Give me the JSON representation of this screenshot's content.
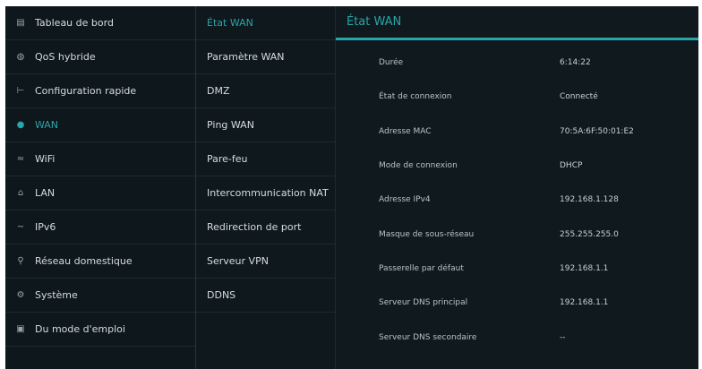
{
  "sidebar": {
    "items": [
      {
        "label": "Tableau de bord",
        "icon": "dashboard-icon",
        "glyph": "▤"
      },
      {
        "label": "QoS hybride",
        "icon": "qos-icon",
        "glyph": "◍"
      },
      {
        "label": "Configuration rapide",
        "icon": "quick-setup-icon",
        "glyph": "⊢"
      },
      {
        "label": "WAN",
        "icon": "globe-icon",
        "glyph": "●"
      },
      {
        "label": "WiFi",
        "icon": "wifi-icon",
        "glyph": "≈"
      },
      {
        "label": "LAN",
        "icon": "lan-icon",
        "glyph": "⌂"
      },
      {
        "label": "IPv6",
        "icon": "ipv6-icon",
        "glyph": "~"
      },
      {
        "label": "Réseau domestique",
        "icon": "home-network-icon",
        "glyph": "⚲"
      },
      {
        "label": "Système",
        "icon": "system-icon",
        "glyph": "⚙"
      },
      {
        "label": "Du mode d'emploi",
        "icon": "manual-icon",
        "glyph": "▣"
      }
    ]
  },
  "submenu": {
    "items": [
      "État WAN",
      "Paramètre WAN",
      "DMZ",
      "Ping WAN",
      "Pare-feu",
      "Intercommunication NAT",
      "Redirection de port",
      "Serveur VPN",
      "DDNS"
    ]
  },
  "content": {
    "title": "État WAN",
    "rows": [
      {
        "label": "Durée",
        "value": "6:14:22"
      },
      {
        "label": "État de connexion",
        "value": "Connecté"
      },
      {
        "label": "Adresse MAC",
        "value": "70:5A:6F:50:01:E2"
      },
      {
        "label": "Mode de connexion",
        "value": "DHCP"
      },
      {
        "label": "Adresse IPv4",
        "value": "192.168.1.128"
      },
      {
        "label": "Masque de sous-réseau",
        "value": "255.255.255.0"
      },
      {
        "label": "Passerelle par défaut",
        "value": "192.168.1.1"
      },
      {
        "label": "Serveur DNS principal",
        "value": "192.168.1.1"
      },
      {
        "label": "Serveur DNS secondaire",
        "value": "--"
      }
    ]
  },
  "colors": {
    "accent": "#2aa5a8",
    "background": "#10191e"
  }
}
